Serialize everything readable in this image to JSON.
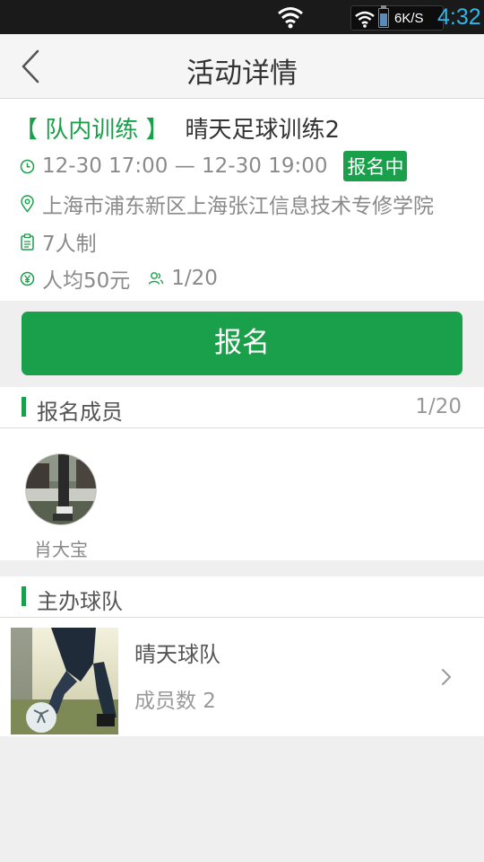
{
  "status_bar": {
    "network_speed": "6K/S",
    "time": "4:32"
  },
  "header": {
    "title": "活动详情"
  },
  "event": {
    "type_tag": "【 队内训练 】",
    "name": "晴天足球训练2",
    "time_range": "12-30 17:00 — 12-30 19:00",
    "status": "报名中",
    "location": "上海市浦东新区上海张江信息技术专修学院",
    "format": "7人制",
    "price": "人均50元",
    "signup_count": "1/20"
  },
  "signup_button": {
    "label": "报名"
  },
  "members_section": {
    "title": "报名成员",
    "count": "1/20",
    "members": [
      {
        "name": "肖大宝"
      }
    ]
  },
  "organizer_section": {
    "title": "主办球队",
    "team": {
      "name": "晴天球队",
      "member_count": "成员数 2"
    }
  },
  "colors": {
    "accent": "#1aa04a",
    "status_time": "#33b5e5"
  },
  "icons": {
    "back": "chevron-left-icon",
    "time": "clock-icon",
    "location": "location-pin-icon",
    "format": "clipboard-icon",
    "price": "yen-icon",
    "people": "people-icon",
    "team_link": "chevron-right-icon"
  }
}
